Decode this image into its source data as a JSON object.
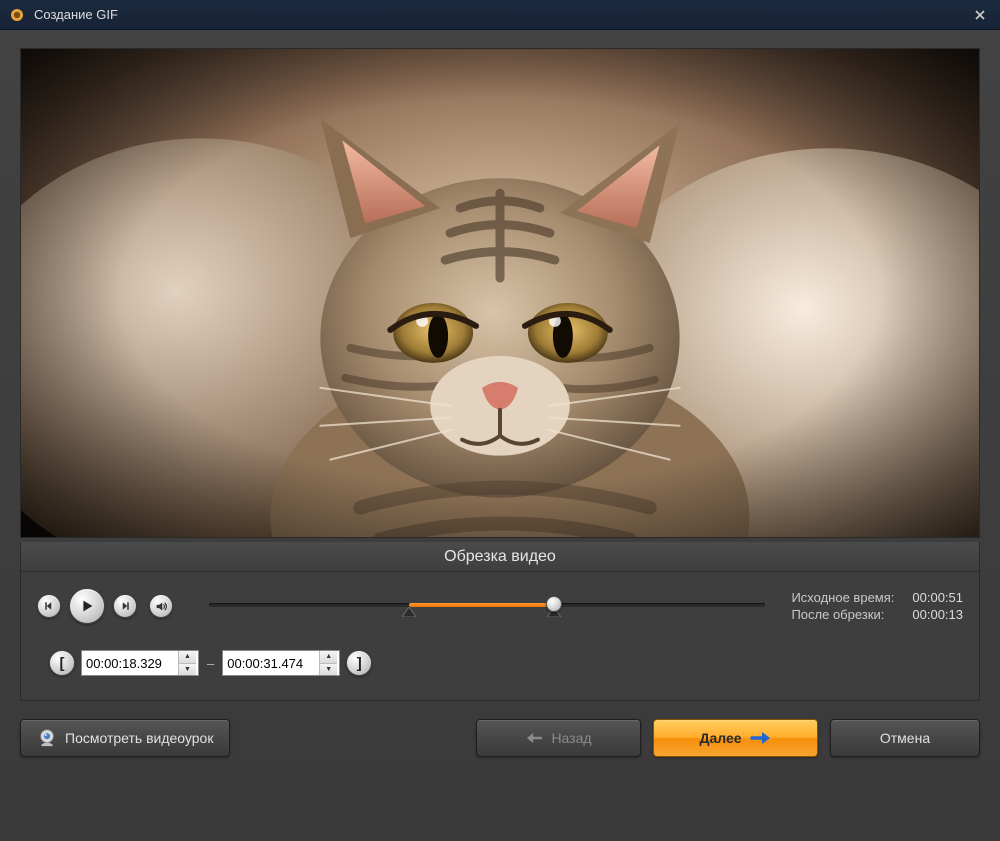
{
  "window": {
    "title": "Создание GIF"
  },
  "section": {
    "label": "Обрезка видео"
  },
  "timeline": {
    "source_label": "Исходное время:",
    "source_value": "00:00:51",
    "after_label": "После обрезки:",
    "after_value": "00:00:13",
    "start_percent": 36,
    "end_percent": 62,
    "playhead_percent": 62
  },
  "time_range": {
    "start": "00:00:18.329",
    "end": "00:00:31.474"
  },
  "footer": {
    "watch_label": "Посмотреть видеоурок",
    "back_label": "Назад",
    "next_label": "Далее",
    "cancel_label": "Отмена"
  }
}
